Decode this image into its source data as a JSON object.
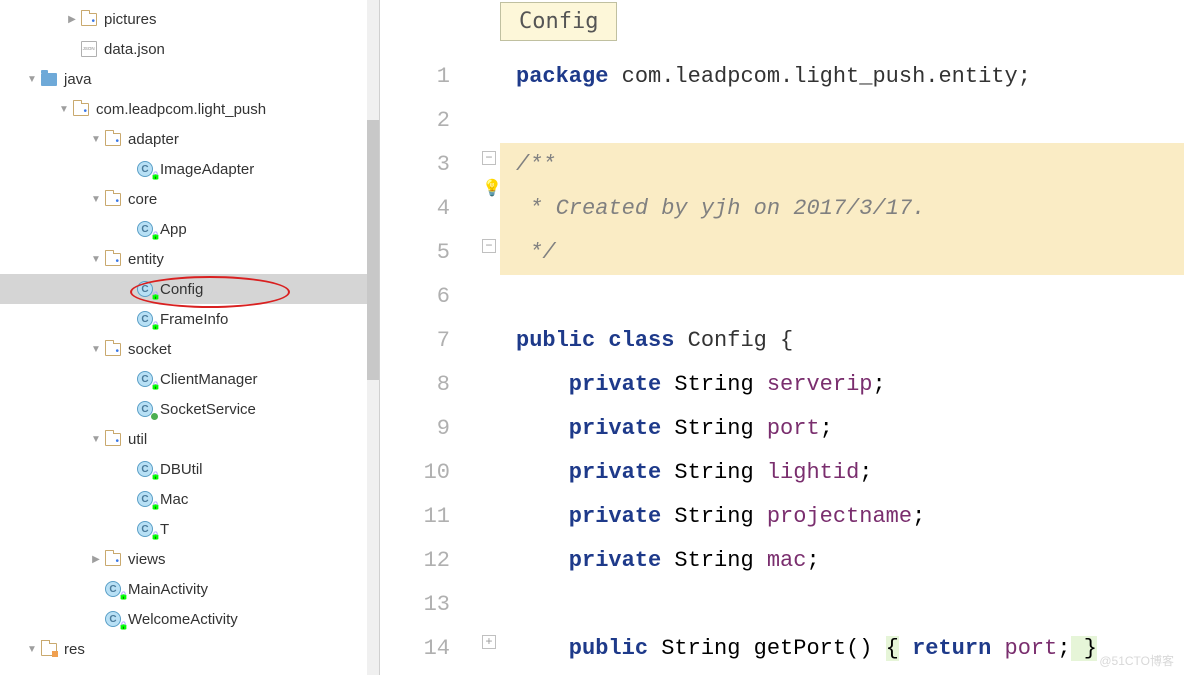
{
  "tree": {
    "pictures": "pictures",
    "datajson": "data.json",
    "java": "java",
    "package": "com.leadpcom.light_push",
    "adapter": "adapter",
    "imageAdapter": "ImageAdapter",
    "core": "core",
    "app": "App",
    "entity": "entity",
    "config": "Config",
    "frameInfo": "FrameInfo",
    "socket": "socket",
    "clientManager": "ClientManager",
    "socketService": "SocketService",
    "util": "util",
    "dbutil": "DBUtil",
    "mac": "Mac",
    "t": "T",
    "views": "views",
    "mainActivity": "MainActivity",
    "welcomeActivity": "WelcomeActivity",
    "res": "res"
  },
  "tab": {
    "label": "Config"
  },
  "code": {
    "l1a": "package",
    "l1b": " com.leadpcom.light_push.entity;",
    "l3": "/**",
    "l4": " * Created by yjh on 2017/3/17.",
    "l5": " */",
    "l7a": "public",
    "l7b": " class",
    "l7c": " Config {",
    "l8a": "    private",
    "l8b": " String ",
    "l8c": "serverip",
    "l8d": ";",
    "l9a": "    private",
    "l9b": " String ",
    "l9c": "port",
    "l9d": ";",
    "l10a": "    private",
    "l10b": " String ",
    "l10c": "lightid",
    "l10d": ";",
    "l11a": "    private",
    "l11b": " String ",
    "l11c": "projectname",
    "l11d": ";",
    "l12a": "    private",
    "l12b": " String ",
    "l12c": "mac",
    "l12d": ";",
    "l14a": "    public",
    "l14b": " String getPort() ",
    "l14c": "{",
    "l14d": " return",
    "l14e": " port",
    "l14f": ";",
    "l14g": " }"
  },
  "lineNumbers": [
    "1",
    "2",
    "3",
    "4",
    "5",
    "6",
    "7",
    "8",
    "9",
    "10",
    "11",
    "12",
    "13",
    "14"
  ],
  "watermark": "@51CTO博客"
}
